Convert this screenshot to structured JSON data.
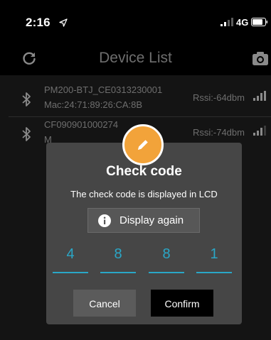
{
  "status_bar": {
    "time": "2:16",
    "network": "4G",
    "icons": [
      "location-arrow-icon",
      "signal-bars-icon",
      "battery-icon"
    ]
  },
  "nav": {
    "title": "Device List",
    "left_icon": "refresh-icon",
    "right_icon": "camera-icon"
  },
  "devices": [
    {
      "name": "PM200-BTJ_CE0313230001",
      "mac": "Mac:24:71:89:26:CA:8B",
      "rssi": "Rssi:-64dbm",
      "icon": "bluetooth-icon"
    },
    {
      "name": "CF090901000274",
      "mac": "M",
      "rssi": "Rssi:-74dbm",
      "icon": "bluetooth-icon"
    }
  ],
  "dialog": {
    "title": "Check code",
    "message": "The check code is displayed in LCD",
    "display_again_label": "Display again",
    "code_digits": [
      "4",
      "8",
      "8",
      "1"
    ],
    "cancel_label": "Cancel",
    "confirm_label": "Confirm",
    "badge_icon": "pencil-icon"
  },
  "colors": {
    "background": "#141414",
    "dialog": "#464646",
    "accent": "#2aa7c7",
    "badge": "#f2a33a",
    "muted_text": "#6e6e6e"
  }
}
